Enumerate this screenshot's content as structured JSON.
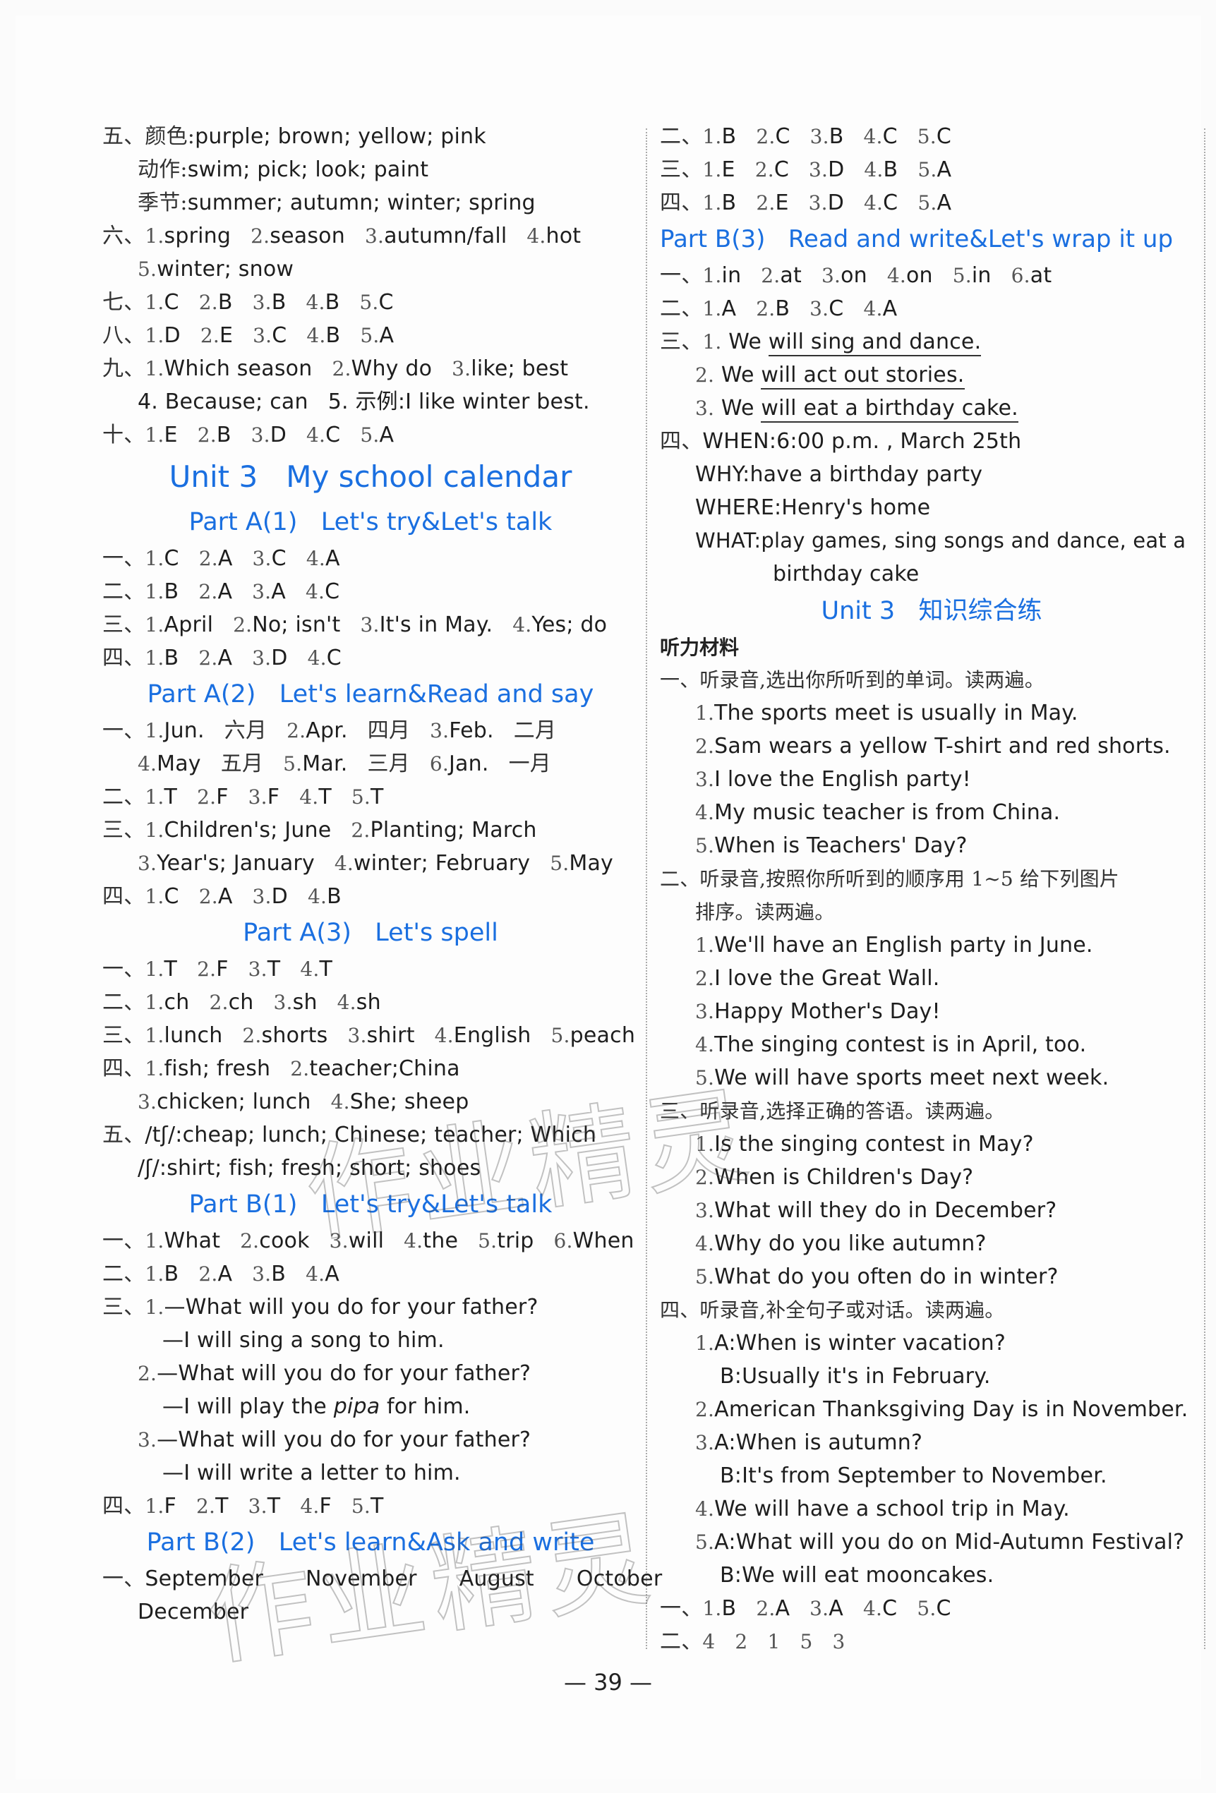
{
  "page_number": "— 39 —",
  "watermark": "作业精灵",
  "left": {
    "s5": {
      "label": "五、",
      "rows": [
        {
          "cn": "颜色:",
          "text": "purple; brown; yellow; pink"
        },
        {
          "cn": "动作:",
          "text": "swim; pick; look; paint"
        },
        {
          "cn": "季节:",
          "text": "summer; autumn; winter; spring"
        }
      ]
    },
    "s6": {
      "label": "六、",
      "line1": [
        "1. spring",
        "2. season",
        "3. autumn/fall",
        "4. hot"
      ],
      "line2": [
        "5. winter; snow"
      ]
    },
    "s7": {
      "label": "七、",
      "items": [
        "1. C",
        "2. B",
        "3. B",
        "4. B",
        "5. C"
      ]
    },
    "s8": {
      "label": "八、",
      "items": [
        "1. D",
        "2. E",
        "3. C",
        "4. B",
        "5. A"
      ]
    },
    "s9": {
      "label": "九、",
      "line1": [
        "1. Which season",
        "2. Why do",
        "3. like; best"
      ],
      "line2_a": "4. Because; can",
      "line2_b": "5. 示例:I like winter best."
    },
    "s10": {
      "label": "十、",
      "items": [
        "1. E",
        "2. B",
        "3. D",
        "4. C",
        "5. A"
      ]
    },
    "unit_title": "Unit 3   My school calendar",
    "partA1": {
      "title": "Part A(1)   Let's try&Let's talk",
      "rows": [
        {
          "label": "一、",
          "items": [
            "1. C",
            "2. A",
            "3. C",
            "4. A"
          ]
        },
        {
          "label": "二、",
          "items": [
            "1. B",
            "2. A",
            "3. A",
            "4. C"
          ]
        },
        {
          "label": "三、",
          "items": [
            "1. April",
            "2. No; isn't",
            "3. It's in May.",
            "4. Yes; do"
          ]
        },
        {
          "label": "四、",
          "items": [
            "1. B",
            "2. A",
            "3. D",
            "4. C"
          ]
        }
      ]
    },
    "partA2": {
      "title": "Part A(2)   Let's learn&Read and say",
      "s1": {
        "label": "一、",
        "line1": [
          [
            "1. Jun.",
            "六月"
          ],
          [
            "2. Apr.",
            "四月"
          ],
          [
            "3. Feb.",
            "二月"
          ]
        ],
        "line2": [
          [
            "4. May",
            "五月"
          ],
          [
            "5. Mar.",
            "三月"
          ],
          [
            "6. Jan.",
            "一月"
          ]
        ]
      },
      "s2": {
        "label": "二、",
        "items": [
          "1. T",
          "2. F",
          "3. F",
          "4. T",
          "5. T"
        ]
      },
      "s3": {
        "label": "三、",
        "line1": [
          "1. Children's; June",
          "2. Planting; March"
        ],
        "line2": [
          "3. Year's; January",
          "4. winter; February",
          "5. May"
        ]
      },
      "s4": {
        "label": "四、",
        "items": [
          "1. C",
          "2. A",
          "3. D",
          "4. B"
        ]
      }
    },
    "partA3": {
      "title": "Part A(3)   Let's spell",
      "s1": {
        "label": "一、",
        "items": [
          "1. T",
          "2. F",
          "3. T",
          "4. T"
        ]
      },
      "s2": {
        "label": "二、",
        "items": [
          "1. ch",
          "2. ch",
          "3. sh",
          "4. sh"
        ]
      },
      "s3": {
        "label": "三、",
        "items": [
          "1. lunch",
          "2. shorts",
          "3. shirt",
          "4. English",
          "5. peach"
        ]
      },
      "s4": {
        "label": "四、",
        "line1": [
          "1. fish; fresh",
          "2. teacher;China"
        ],
        "line2": [
          "3. chicken; lunch",
          "4. She; sheep"
        ]
      },
      "s5": {
        "label": "五、",
        "line1": "/tʃ/:cheap; lunch; Chinese; teacher; Which",
        "line2": "/ʃ/:shirt; fish; fresh; short; shoes"
      }
    },
    "partB1": {
      "title": "Part B(1)   Let's try&Let's talk",
      "s1": {
        "label": "一、",
        "items": [
          "1. What",
          "2. cook",
          "3. will",
          "4. the",
          "5. trip",
          "6. When"
        ]
      },
      "s2": {
        "label": "二、",
        "items": [
          "1. B",
          "2. A",
          "3. B",
          "4. A"
        ]
      },
      "s3": {
        "label": "三、",
        "dialogs": [
          {
            "num": "1.",
            "q": "—What will you do for your father?",
            "a_pre": "—I will sing a song to him.",
            "a_it": "",
            "a_post": ""
          },
          {
            "num": "2.",
            "q": "—What will you do for your father?",
            "a_pre": "—I will play the ",
            "a_it": "pipa",
            "a_post": " for him."
          },
          {
            "num": "3.",
            "q": "—What will you do for your father?",
            "a_pre": "—I will write a letter to him.",
            "a_it": "",
            "a_post": ""
          }
        ]
      },
      "s4": {
        "label": "四、",
        "items": [
          "1. F",
          "2. T",
          "3. T",
          "4. F",
          "5. T"
        ]
      }
    },
    "partB2": {
      "title": "Part B(2)   Let's learn&Ask and write",
      "s1": {
        "label": "一、",
        "line1": [
          "September",
          "November",
          "August",
          "October"
        ],
        "line2": [
          "December"
        ]
      }
    }
  },
  "right": {
    "top": [
      {
        "label": "二、",
        "items": [
          "1. B",
          "2. C",
          "3. B",
          "4. C",
          "5. C"
        ]
      },
      {
        "label": "三、",
        "items": [
          "1. E",
          "2. C",
          "3. D",
          "4. B",
          "5. A"
        ]
      },
      {
        "label": "四、",
        "items": [
          "1. B",
          "2. E",
          "3. D",
          "4. C",
          "5. A"
        ]
      }
    ],
    "partB3": {
      "title": "Part B(3)   Read and write&Let's wrap it up",
      "s1": {
        "label": "一、",
        "items": [
          "1. in",
          "2. at",
          "3. on",
          "4. on",
          "5. in",
          "6. at"
        ]
      },
      "s2": {
        "label": "二、",
        "items": [
          "1. A",
          "2. B",
          "3. C",
          "4. A"
        ]
      },
      "s3": {
        "label": "三、",
        "rows": [
          {
            "num": "1.",
            "pre": "We ",
            "underlined": "will sing and dance."
          },
          {
            "num": "2.",
            "pre": "We ",
            "underlined": "will act out stories."
          },
          {
            "num": "3.",
            "pre": "We ",
            "underlined": "will eat a birthday cake."
          }
        ]
      },
      "s4": {
        "label": "四、",
        "when": "WHEN:6:00 p.m. , March 25th",
        "why": "WHY:have a birthday party",
        "where": "WHERE:Henry's home",
        "what": "WHAT:play games, sing songs and dance, eat a",
        "what_cont": "birthday cake"
      }
    },
    "review": {
      "title": "Unit 3   知识综合练",
      "listening_label": "听力材料",
      "q1": {
        "instruction": "一、听录音,选出你所听到的单词。读两遍。",
        "items": [
          "1. The sports meet is usually in May.",
          "2. Sam wears a yellow T-shirt and red shorts.",
          "3. I love the English party!",
          "4. My music teacher is from China.",
          "5. When is Teachers' Day?"
        ]
      },
      "q2": {
        "instruction_1": "二、听录音,按照你所听到的顺序用 1~5 给下列图片",
        "instruction_2": "排序。读两遍。",
        "items": [
          "1. We'll have an English party in June.",
          "2. I love the Great Wall.",
          "3. Happy Mother's Day!",
          "4. The singing contest is in April, too.",
          "5. We will have sports meet next week."
        ]
      },
      "q3": {
        "instruction": "三、听录音,选择正确的答语。读两遍。",
        "items": [
          "1. Is the singing contest in May?",
          "2. When is Children's Day?",
          "3. What will they do in December?",
          "4. Why do you like autumn?",
          "5. What do you often do in winter?"
        ]
      },
      "q4": {
        "instruction": "四、听录音,补全句子或对话。读两遍。",
        "lines": [
          {
            "text": "1. A:When is winter vacation?",
            "sub": false
          },
          {
            "text": "B:Usually it's in February.",
            "sub": true
          },
          {
            "text": "2. American Thanksgiving Day is in November.",
            "sub": false
          },
          {
            "text": "3. A:When is autumn?",
            "sub": false
          },
          {
            "text": "B:It's from September to November.",
            "sub": true
          },
          {
            "text": "4. We will have a school trip in May.",
            "sub": false
          },
          {
            "text": "5. A:What will you do on Mid-Autumn Festival?",
            "sub": false
          },
          {
            "text": "B:We will eat mooncakes.",
            "sub": true
          }
        ]
      },
      "ans1": {
        "label": "一、",
        "items": [
          "1. B",
          "2. A",
          "3. A",
          "4. C",
          "5. C"
        ]
      },
      "ans2": {
        "label": "二、",
        "items": [
          "4",
          "2",
          "1",
          "5",
          "3"
        ]
      }
    }
  },
  "colors": {
    "heading": "#1a6fe0",
    "text": "#1e1e1e",
    "background": "#fdfdfd"
  }
}
